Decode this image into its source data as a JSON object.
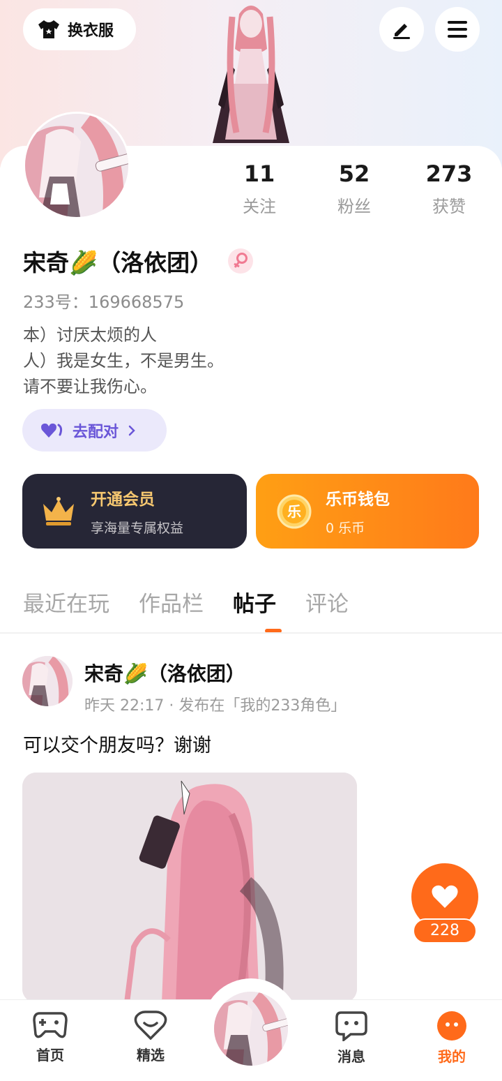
{
  "header": {
    "dress_label": "换衣服",
    "dress_icon": "shirt-icon",
    "edit_icon": "pencil-icon",
    "menu_icon": "hamburger-menu-icon"
  },
  "profile": {
    "name": "宋奇🌽（洛依团）",
    "gender_icon": "female-icon",
    "uid": "233号：169668575",
    "bio": [
      "本）讨厌太烦的人",
      "人）我是女生，不是男生。",
      "请不要让我伤心。"
    ],
    "stats": [
      {
        "value": "11",
        "label": "关注"
      },
      {
        "value": "52",
        "label": "粉丝"
      },
      {
        "value": "273",
        "label": "获赞"
      }
    ]
  },
  "match": {
    "label": "去配对",
    "icon": "heart-pair-icon"
  },
  "features": {
    "vip": {
      "title": "开通会员",
      "subtitle": "享海量专属权益",
      "icon": "crown-icon"
    },
    "coin": {
      "title": "乐币钱包",
      "subtitle": "0 乐币",
      "icon_text": "乐"
    }
  },
  "tabs": [
    {
      "label": "最近在玩",
      "active": false
    },
    {
      "label": "作品栏",
      "active": false
    },
    {
      "label": "帖子",
      "active": true
    },
    {
      "label": "评论",
      "active": false
    }
  ],
  "post": {
    "author": "宋奇🌽（洛依团）",
    "meta": "昨天 22:17 · 发布在「我的233角色」",
    "text": "可以交个朋友吗？谢谢",
    "likes": "228"
  },
  "nav": [
    {
      "label": "首页",
      "icon": "gamepad-icon",
      "active": false
    },
    {
      "label": "精选",
      "icon": "heart-badge-icon",
      "active": false
    },
    {
      "label": "消息",
      "icon": "chat-icon",
      "active": false
    },
    {
      "label": "我的",
      "icon": "profile-face-icon",
      "active": true
    }
  ],
  "colors": {
    "accent": "#ff6a1a",
    "vip_bg": "#262636",
    "match_text": "#6a56d8"
  }
}
